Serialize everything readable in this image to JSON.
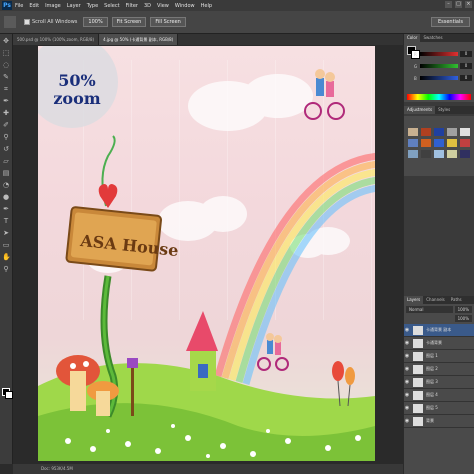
{
  "menubar": {
    "logo": "Ps",
    "items": [
      "File",
      "Edit",
      "Image",
      "Layer",
      "Type",
      "Select",
      "Filter",
      "3D",
      "View",
      "Window",
      "Help"
    ],
    "controls": [
      "–",
      "□",
      "×"
    ]
  },
  "options": {
    "scroll_all": "Scroll All Windows",
    "zoom_value": "100%",
    "fit_screen": "Fit Screen",
    "fill_screen": "Fill Screen",
    "workspace": "Essentials"
  },
  "tabs": [
    {
      "label": "500.psd @ 100% (100%,zoom, RGB/8)",
      "active": false
    },
    {
      "label": "4.jpg @ 50% (卡通背景 副本, RGB/8)",
      "active": true
    }
  ],
  "canvas": {
    "zoom_badge_value": "50%",
    "zoom_badge_word": "zoom",
    "sign_text": "ASA House"
  },
  "status": {
    "text": "Doc: 953K/4.5M"
  },
  "panels": {
    "color_tabs": [
      "Color",
      "Swatches"
    ],
    "sliders": [
      {
        "label": "R",
        "value": "0",
        "color": "#e03030"
      },
      {
        "label": "G",
        "value": "0",
        "color": "#30c030"
      },
      {
        "label": "B",
        "value": "0",
        "color": "#3060e0"
      }
    ],
    "adjust_tabs": [
      "Adjustments",
      "Styles"
    ],
    "layer_tabs": [
      "Layers",
      "Channels",
      "Paths"
    ],
    "blend_mode": "Normal",
    "opacity": "100%",
    "fill": "100%",
    "layers": [
      {
        "name": "卡通背景 副本",
        "selected": true
      },
      {
        "name": "卡通背景",
        "selected": false
      },
      {
        "name": "图层 1",
        "selected": false
      },
      {
        "name": "图层 2",
        "selected": false
      },
      {
        "name": "图层 3",
        "selected": false
      },
      {
        "name": "图层 4",
        "selected": false
      },
      {
        "name": "图层 5",
        "selected": false
      },
      {
        "name": "背景",
        "selected": false
      }
    ]
  }
}
